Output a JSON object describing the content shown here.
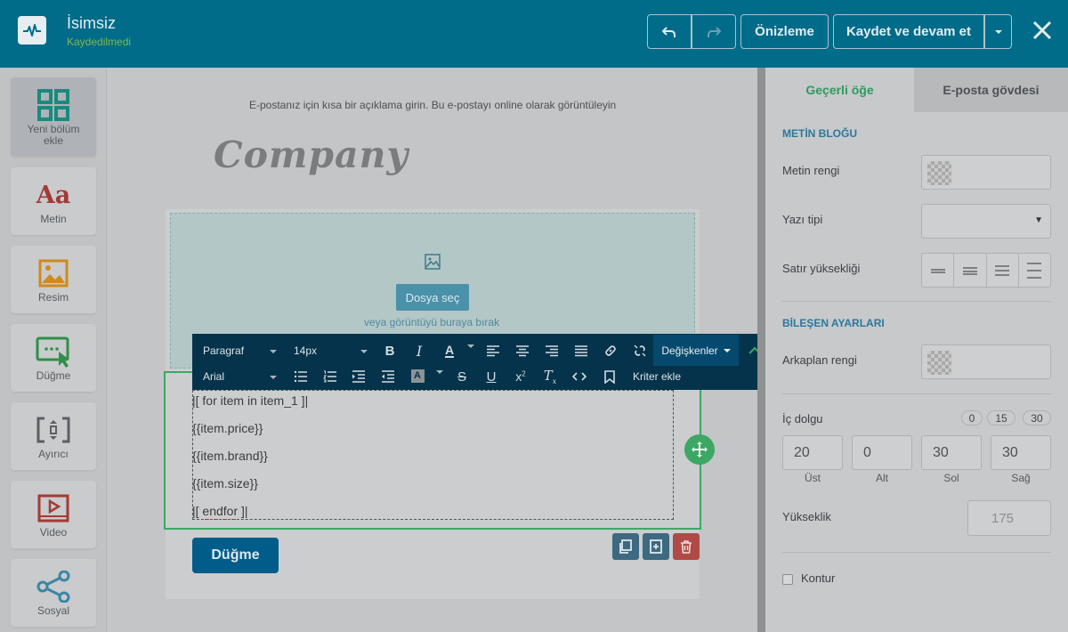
{
  "header": {
    "title": "İsimsiz",
    "subtitle": "Kaydedilmedi",
    "preview_label": "Önizleme",
    "save_label": "Kaydet ve devam et"
  },
  "sidebar": {
    "items": [
      {
        "label": "Yeni bölüm ekle"
      },
      {
        "label": "Metin"
      },
      {
        "label": "Resim"
      },
      {
        "label": "Düğme"
      },
      {
        "label": "Ayırıcı"
      },
      {
        "label": "Video"
      },
      {
        "label": "Sosyal"
      }
    ]
  },
  "canvas": {
    "preheader_text": "E-postanız için kısa bir açıklama girin. Bu e-postayı online olarak görüntüleyin",
    "logo_text": "Company",
    "upload_button": "Dosya seç",
    "upload_hint": "veya görüntüyü buraya bırak",
    "text_lines": [
      "|[ for item in item_1 ]|",
      "{{item.price}}",
      "{{item.brand}}",
      "{{item.size}}",
      "|[ endfor ]|"
    ],
    "button_label": "Düğme"
  },
  "editor_toolbar": {
    "format_value": "Paragraf",
    "size_value": "14px",
    "font_value": "Arial",
    "variables_label": "Değişkenler",
    "criteria_label": "Kriter ekle"
  },
  "right_panel": {
    "tab_current": "Geçerli öğe",
    "tab_body": "E-posta gövdesi",
    "section_text_block": "METİN BLOĞU",
    "text_color_label": "Metin rengi",
    "font_label": "Yazı tipi",
    "line_height_label": "Satır yüksekliği",
    "section_component": "BİLEŞEN AYARLARI",
    "bg_color_label": "Arkaplan rengi",
    "padding_label": "İç dolgu",
    "padding_presets": [
      "0",
      "15",
      "30"
    ],
    "padding": {
      "top": {
        "value": "20",
        "label": "Üst"
      },
      "bottom": {
        "value": "0",
        "label": "Alt"
      },
      "left": {
        "value": "30",
        "label": "Sol"
      },
      "right": {
        "value": "30",
        "label": "Sağ"
      }
    },
    "height_label": "Yükseklik",
    "height_value": "175",
    "border_label": "Kontur"
  },
  "colors": {
    "header_bg": "#006c8a",
    "accent_green": "#3ca864",
    "toolbar_bg": "#04334b",
    "section_blue": "#2b789e"
  }
}
